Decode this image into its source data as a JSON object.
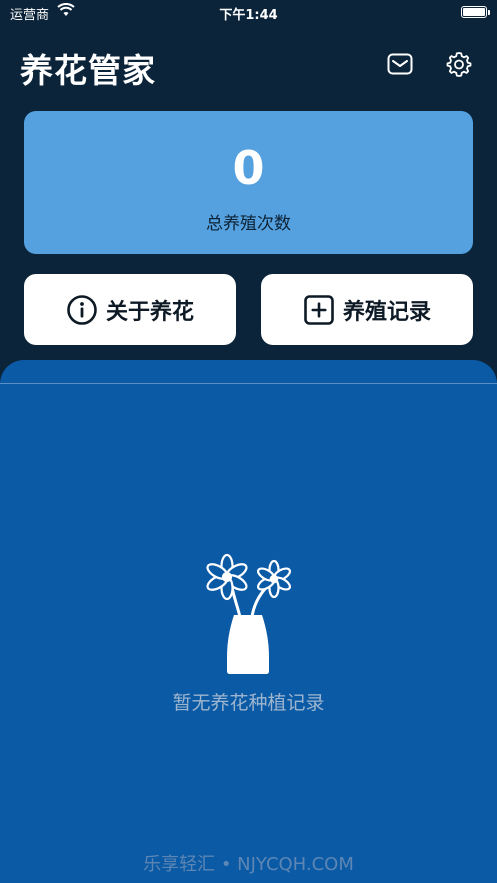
{
  "status_bar": {
    "carrier": "运营商",
    "time": "下午1:44"
  },
  "header": {
    "title": "养花管家",
    "icons": [
      "mail-icon",
      "gear-icon"
    ]
  },
  "stats": {
    "count": "0",
    "label": "总养殖次数"
  },
  "actions": {
    "about_label": "关于养花",
    "record_label": "养殖记录"
  },
  "records": {
    "empty_text": "暂无养花种植记录"
  },
  "footer": {
    "text": "乐享轻汇 • NJYCQH.COM"
  },
  "colors": {
    "background": "#0b2439",
    "stats_card": "#55a1df",
    "panel": "#0b5aa6",
    "button": "#ffffff"
  }
}
